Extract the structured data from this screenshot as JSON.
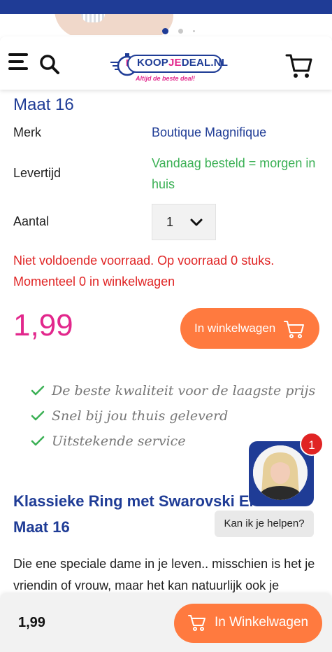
{
  "header": {
    "logo": {
      "brand_part1": "KOOP",
      "brand_part2": "JE",
      "brand_part3": "DEAL.NL",
      "slogan": "Altijd de beste deal!"
    },
    "icons": [
      "menu-icon",
      "search-icon",
      "cart-icon"
    ]
  },
  "carousel": {
    "active_dot": 1,
    "dot_count": 3
  },
  "product": {
    "size_title": "Maat 16",
    "specs": {
      "brand_label": "Merk",
      "brand_value": "Boutique Magnifique",
      "delivery_label": "Levertijd",
      "delivery_value": "Vandaag besteld = morgen in huis",
      "quantity_label": "Aantal",
      "quantity_value": "1"
    },
    "stock_warning": "Niet voldoende voorraad. Op voorraad 0 stuks. Momenteel 0 in winkelwagen",
    "price": "1,99",
    "add_to_cart_label": "In winkelwagen",
    "usps": [
      "De beste kwaliteit voor de laagste prijs",
      "Snel bij jou thuis geleverd",
      "Uitstekende service"
    ],
    "title_line1": "Klassieke Ring met Swarovski Ele",
    "title_line2": "Maat 16",
    "description": "Die ene speciale dame in je leven.. misschien is het je vriendin of vrouw, maar het kan natuurlijk ook je"
  },
  "chat": {
    "badge_count": "1",
    "bubble_text": "Kan ik je helpen?"
  },
  "sticky_bar": {
    "price": "1,99",
    "button_label": "In Winkelwagen"
  },
  "colors": {
    "brand_blue": "#1f3c96",
    "price_pink": "#e2278c",
    "cta_orange": "#ff7a3f",
    "delivery_green": "#3ab054",
    "warning_red": "#e02424"
  }
}
